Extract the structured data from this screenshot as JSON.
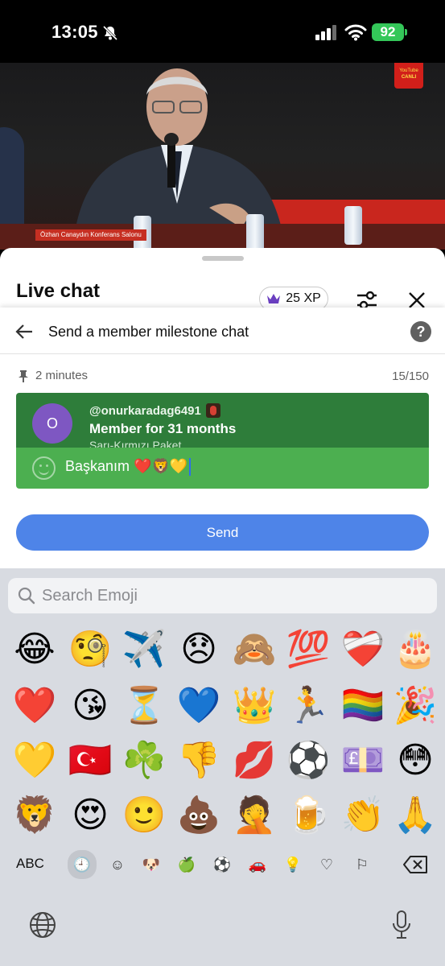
{
  "status": {
    "time": "13:05",
    "battery": "92"
  },
  "video": {
    "ticker": "Özhan Canaydın Konferans Salonu",
    "badge_line1": "YouTube",
    "badge_line2": "CANLI"
  },
  "sheet": {
    "title": "Live chat",
    "xp": "25 XP"
  },
  "panel": {
    "title": "Send a member milestone chat",
    "help": "?",
    "pin_label": "2 minutes",
    "char_count": "15/150",
    "card": {
      "avatar_letter": "O",
      "handle": "@onurkaradag6491",
      "milestone": "Member for 31 months",
      "membership": "Sarı-Kırmızı Paket",
      "message": "Başkanım ❤️🦁💛"
    },
    "send_label": "Send"
  },
  "keyboard": {
    "search_placeholder": "Search Emoji",
    "rows": [
      [
        "😂",
        "🧐",
        "✈️",
        "😞",
        "🙈",
        "💯",
        "❤️‍🩹",
        "🎂"
      ],
      [
        "❤️",
        "😘",
        "⏳",
        "💙",
        "👑",
        "🏃",
        "🏳️‍🌈",
        "🎉"
      ],
      [
        "💛",
        "🇹🇷",
        "☘️",
        "👎",
        "💋",
        "⚽",
        "💷",
        "😳"
      ],
      [
        "🦁",
        "😍",
        "🙂",
        "💩",
        "🤦",
        "🍺",
        "👏",
        "🙏"
      ]
    ],
    "abc_label": "ABC",
    "categories": [
      "🕘",
      "☺",
      "🐶",
      "🍏",
      "⚽",
      "🚗",
      "💡",
      "♡",
      "⚐"
    ]
  }
}
